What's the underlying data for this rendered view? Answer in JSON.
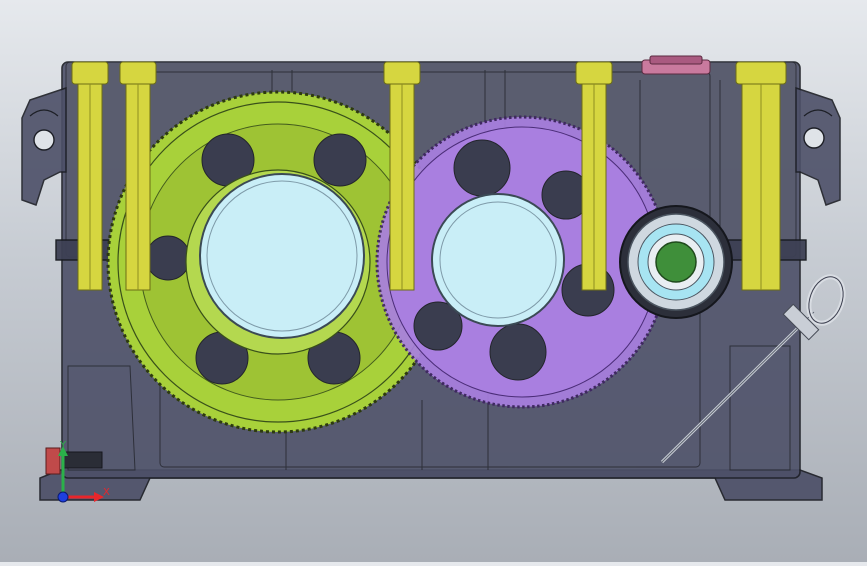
{
  "view": {
    "background_top": "#e6e9ed",
    "background_bottom": "#a9aeb6"
  },
  "colors": {
    "housing_fill": "#4d5068",
    "housing_edge": "#1d1f26",
    "bolt": "#d6d640",
    "bolt_edge": "#6d6d14",
    "large_gear": "#a8d13a",
    "mid_gear": "#a97fe0",
    "shaft_bore": "#c9eef7",
    "pinion_bore": "#cfd8e0",
    "pinion_core": "#3f8f3a",
    "eye_bolt": "#d9dde3",
    "axis_x": "#e8262b",
    "axis_y": "#2bb14a",
    "axis_z": "#1e3fe0"
  },
  "triad": {
    "x_label": "X",
    "y_label": "Y"
  },
  "components": {
    "large_gear": "spur-gear-large",
    "mid_gear": "spur-gear-intermediate",
    "pinion": "pinion-shaft",
    "housing": "gearbox-housing",
    "bolts": "tie-bolt",
    "dipstick": "oil-dipstick",
    "breather": "breather-cap",
    "lifting": "lifting-lug"
  }
}
